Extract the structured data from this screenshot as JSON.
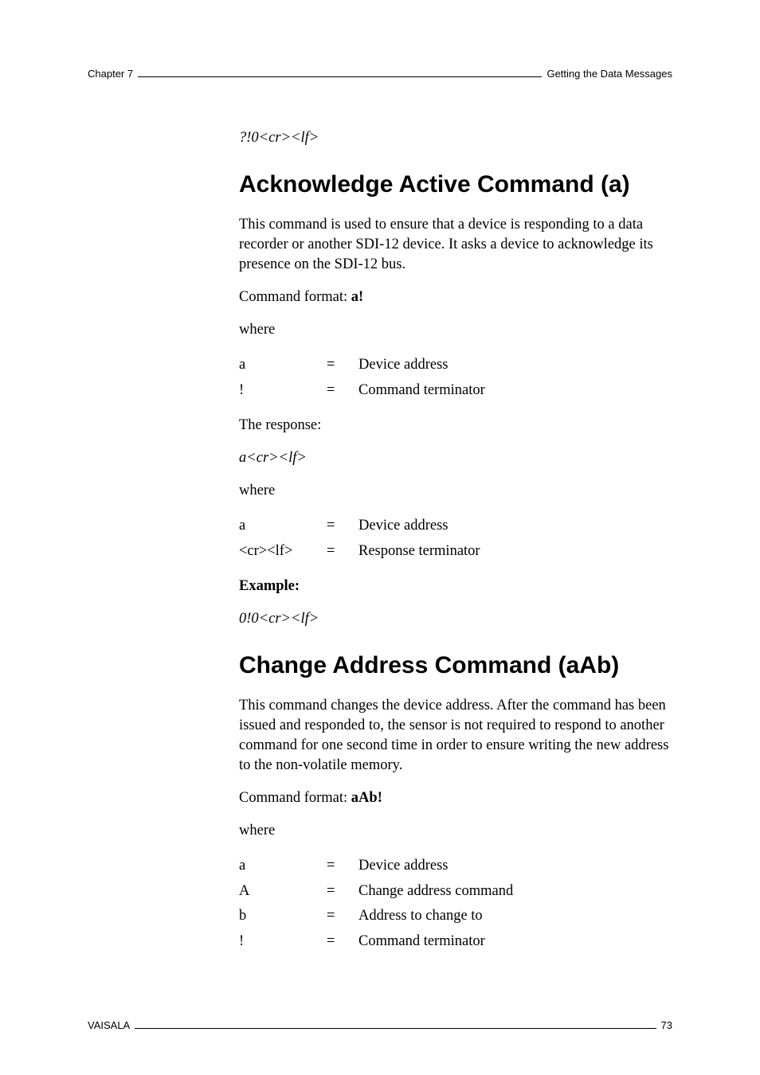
{
  "runhead": {
    "left": "Chapter 7",
    "right": "Getting the Data Messages"
  },
  "intro_response": "?!0<cr><lf>",
  "sec1": {
    "title": "Acknowledge Active Command (a)",
    "p1": "This command is used to ensure that a device is responding to a data recorder or another SDI-12 device. It asks a device to acknowledge its presence on the SDI-12 bus.",
    "cmd_prefix": "Command format: ",
    "cmd": "a!",
    "where": "where",
    "defs1": [
      {
        "term": "a",
        "eq": "=",
        "desc": "Device address"
      },
      {
        "term": "!",
        "eq": "=",
        "desc": "Command terminator"
      }
    ],
    "resp_label": "The response:",
    "resp": "a<cr><lf>",
    "defs2": [
      {
        "term": "a",
        "eq": "=",
        "desc": "Device address"
      },
      {
        "term": "<cr><lf>",
        "eq": "=",
        "desc": "Response terminator"
      }
    ],
    "example_label": "Example:",
    "example": "0!0<cr><lf>"
  },
  "sec2": {
    "title": "Change Address Command (aAb)",
    "p1": "This command changes the device address. After the command has been issued and responded to, the sensor is not required to respond to another command for one second time in order to ensure writing the new address to the non-volatile memory.",
    "cmd_prefix": "Command format: ",
    "cmd": "aAb!",
    "where": "where",
    "defs": [
      {
        "term": "a",
        "eq": "=",
        "desc": "Device address"
      },
      {
        "term": "A",
        "eq": "=",
        "desc": "Change address command"
      },
      {
        "term": "b",
        "eq": "=",
        "desc": "Address to change to"
      },
      {
        "term": "!",
        "eq": "=",
        "desc": "Command terminator"
      }
    ]
  },
  "footer": {
    "left": "VAISALA",
    "right": "73"
  }
}
